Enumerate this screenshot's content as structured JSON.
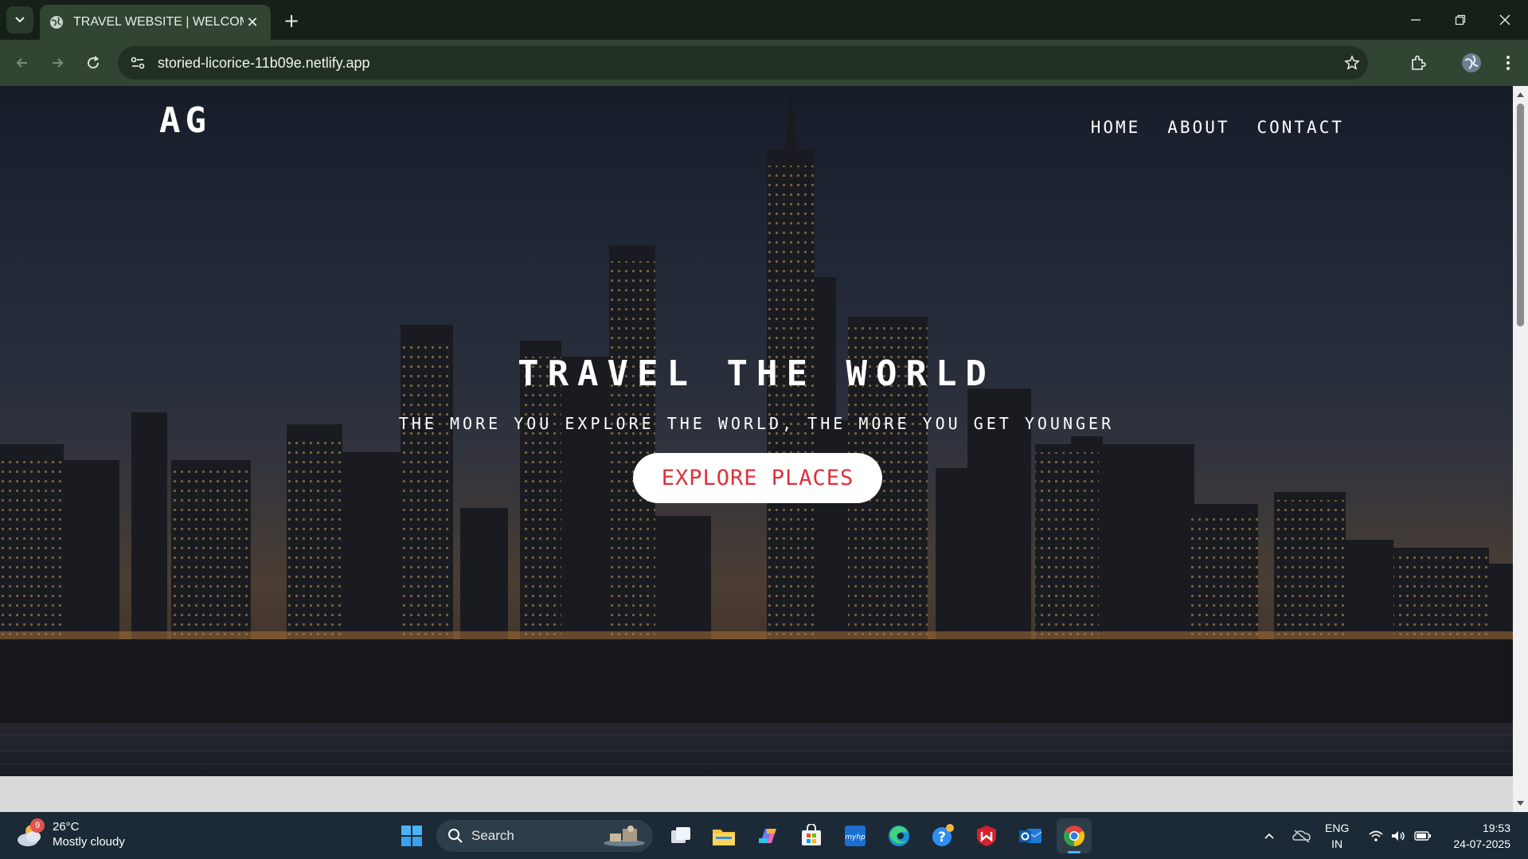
{
  "browser": {
    "tab_title": "TRAVEL WEBSITE | WELCOME",
    "url": "storied-licorice-11b09e.netlify.app"
  },
  "site": {
    "logo": "AG",
    "nav": [
      "HOME",
      "ABOUT",
      "CONTACT"
    ],
    "headline": "TRAVEL THE WORLD",
    "tagline": "THE MORE YOU EXPLORE THE WORLD, THE MORE YOU GET YOUNGER",
    "cta": "EXPLORE PLACES",
    "accent": "#e0303a"
  },
  "taskbar": {
    "weather_temp": "26°C",
    "weather_desc": "Mostly cloudy",
    "weather_badge": "9",
    "search": "Search",
    "lang_top": "ENG",
    "lang_bottom": "IN",
    "time": "19:53",
    "date": "24-07-2025"
  }
}
